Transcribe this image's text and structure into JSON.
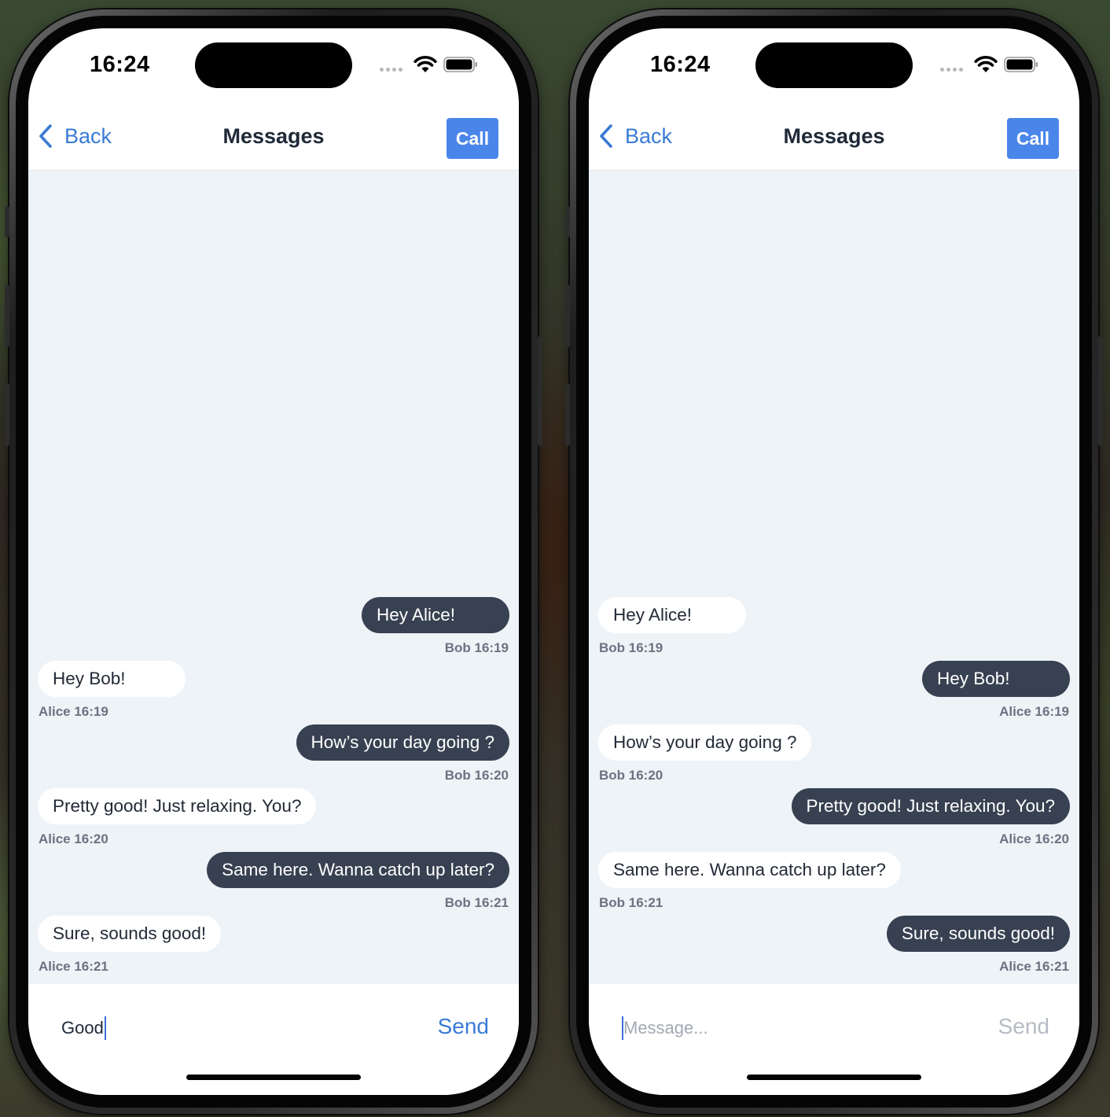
{
  "colors": {
    "accent": "#3a7bd5",
    "call_button_bg": "#4a86ea",
    "outgoing_bubble": "#374151",
    "incoming_bubble": "#ffffff",
    "chat_background": "#eef3f8",
    "caret": "#3b6fd8"
  },
  "phones": [
    {
      "status_bar": {
        "time": "16:24"
      },
      "nav": {
        "back_label": "Back",
        "title": "Messages",
        "call_label": "Call"
      },
      "messages": [
        {
          "text": "Hey Alice!",
          "meta": "Bob 16:19",
          "side": "outgoing"
        },
        {
          "text": "Hey Bob!",
          "meta": "Alice 16:19",
          "side": "incoming"
        },
        {
          "text": "How’s your day going ?",
          "meta": "Bob 16:20",
          "side": "outgoing"
        },
        {
          "text": "Pretty good! Just relaxing. You?",
          "meta": "Alice 16:20",
          "side": "incoming"
        },
        {
          "text": "Same here. Wanna catch up later?",
          "meta": "Bob 16:21",
          "side": "outgoing"
        },
        {
          "text": "Sure, sounds good!",
          "meta": "Alice 16:21",
          "side": "incoming"
        }
      ],
      "composer": {
        "value": "Good",
        "placeholder": "",
        "send_label": "Send",
        "send_enabled": true
      }
    },
    {
      "status_bar": {
        "time": "16:24"
      },
      "nav": {
        "back_label": "Back",
        "title": "Messages",
        "call_label": "Call"
      },
      "messages": [
        {
          "text": "Hey Alice!",
          "meta": "Bob 16:19",
          "side": "incoming"
        },
        {
          "text": "Hey Bob!",
          "meta": "Alice 16:19",
          "side": "outgoing"
        },
        {
          "text": "How’s your day going ?",
          "meta": "Bob 16:20",
          "side": "incoming"
        },
        {
          "text": "Pretty good! Just relaxing. You?",
          "meta": "Alice 16:20",
          "side": "outgoing"
        },
        {
          "text": "Same here. Wanna catch up later?",
          "meta": "Bob 16:21",
          "side": "incoming"
        },
        {
          "text": "Sure, sounds good!",
          "meta": "Alice 16:21",
          "side": "outgoing"
        }
      ],
      "composer": {
        "value": "",
        "placeholder": "Message...",
        "send_label": "Send",
        "send_enabled": false
      }
    }
  ]
}
